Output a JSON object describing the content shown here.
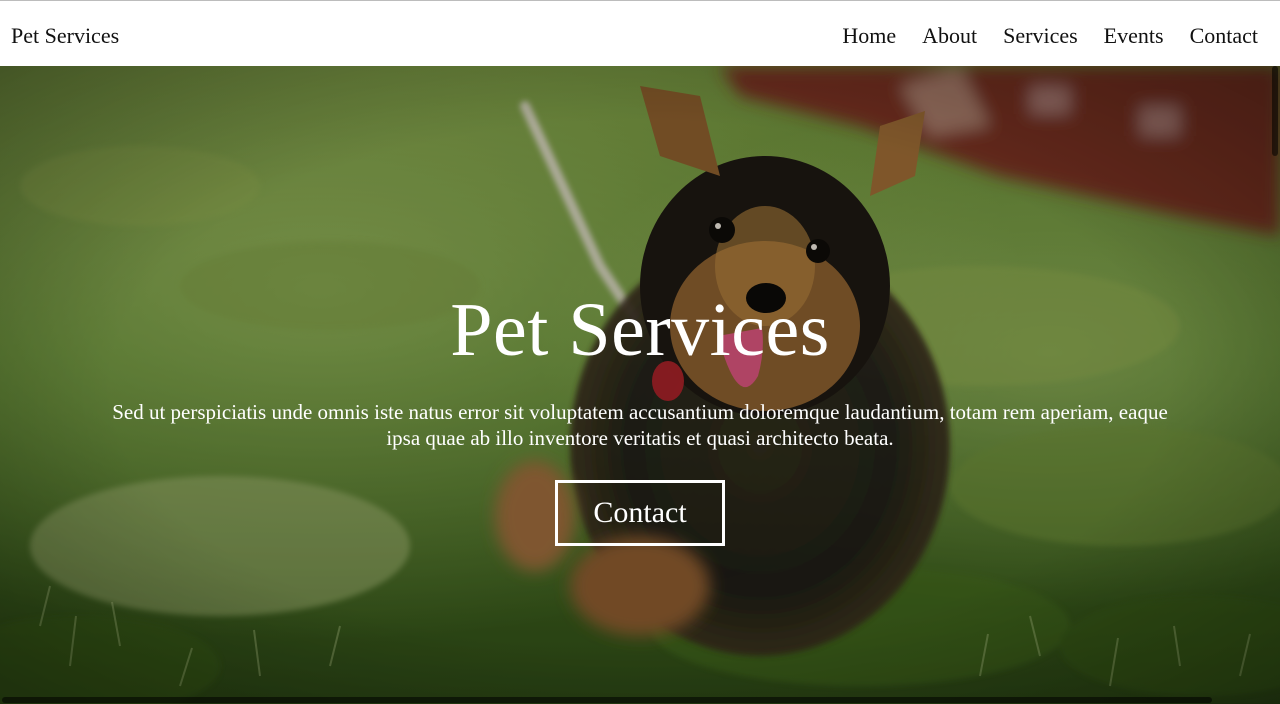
{
  "navbar": {
    "brand": "Pet Services",
    "links": [
      "Home",
      "About",
      "Services",
      "Events",
      "Contact"
    ]
  },
  "hero": {
    "title": "Pet Services",
    "text": "Sed ut perspiciatis unde omnis iste natus error sit voluptatem accusantium doloremque laudantium, totam rem aperiam, eaque ipsa quae ab illo inventore veritatis et quasi architecto beata.",
    "button_label": "Contact",
    "image": "yorkshire-terrier-puppy-running-on-grass-photo"
  },
  "colors": {
    "nav_bg": "#ffffff",
    "nav_text": "#111111",
    "hero_text": "#ffffff",
    "grass": "#5b8a2e",
    "dog_dark": "#1e1a14",
    "dog_tan": "#b07a3c"
  }
}
